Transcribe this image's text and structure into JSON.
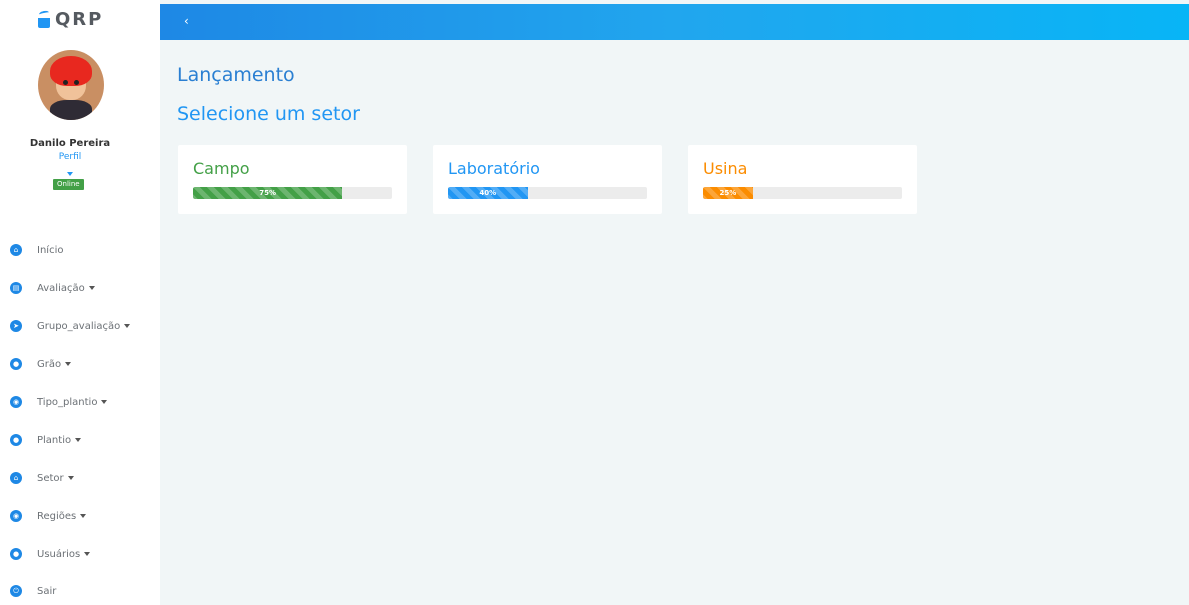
{
  "brand": {
    "name": "QRP"
  },
  "user": {
    "name": "Danilo Pereira",
    "profile_link": "Perfil",
    "status": "Online"
  },
  "menu": [
    {
      "label": "Início",
      "icon": "home-icon",
      "has_dropdown": false
    },
    {
      "label": "Avaliação",
      "icon": "clipboard-icon",
      "has_dropdown": true
    },
    {
      "label": "Grupo_avaliação",
      "icon": "send-icon",
      "has_dropdown": true
    },
    {
      "label": "Grão",
      "icon": "grain-icon",
      "has_dropdown": true
    },
    {
      "label": "Tipo_plantio",
      "icon": "location-icon",
      "has_dropdown": true
    },
    {
      "label": "Plantio",
      "icon": "user-circle-icon",
      "has_dropdown": true
    },
    {
      "label": "Setor",
      "icon": "home-icon",
      "has_dropdown": true
    },
    {
      "label": "Regiões",
      "icon": "location-icon",
      "has_dropdown": true
    },
    {
      "label": "Usuários",
      "icon": "user-circle-icon",
      "has_dropdown": true
    },
    {
      "label": "Sair",
      "icon": "power-icon",
      "has_dropdown": false
    }
  ],
  "topbar": {
    "back_label": "‹"
  },
  "main": {
    "title": "Lançamento",
    "subtitle": "Selecione um setor",
    "sectors": [
      {
        "name": "Campo",
        "percent": 75,
        "percent_label": "75%",
        "color": "#43a047"
      },
      {
        "name": "Laboratório",
        "percent": 40,
        "percent_label": "40%",
        "color": "#2196f3"
      },
      {
        "name": "Usina",
        "percent": 25,
        "percent_label": "25%",
        "color": "#fb8c00"
      }
    ]
  }
}
